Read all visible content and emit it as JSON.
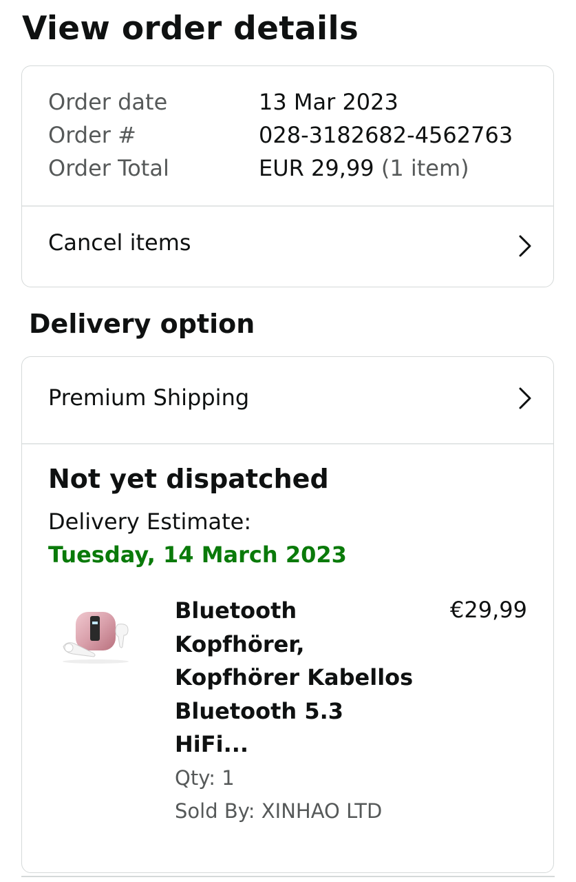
{
  "page": {
    "title": "View order details"
  },
  "order_summary": {
    "rows": [
      {
        "label": "Order date",
        "value": "13 Mar 2023",
        "suffix": ""
      },
      {
        "label": "Order #",
        "value": "028-3182682-4562763",
        "suffix": ""
      },
      {
        "label": "Order Total",
        "value": "EUR 29,99",
        "suffix": "(1 item)"
      }
    ],
    "cancel_label": "Cancel items"
  },
  "delivery": {
    "section_title": "Delivery option",
    "shipping_label": "Premium Shipping",
    "status": "Not yet dispatched",
    "estimate_label": "Delivery Estimate:",
    "estimate_date": "Tuesday, 14 March 2023",
    "item": {
      "title_lines": [
        "Bluetooth",
        "Kopfhörer,",
        "Kopfhörer Kabellos",
        "Bluetooth 5.3",
        "HiFi..."
      ],
      "price": "€29,99",
      "qty": "Qty: 1",
      "seller": "Sold By: XINHAO LTD",
      "image_icon": "earbuds-product-image"
    }
  },
  "colors": {
    "text": "#0f1111",
    "muted": "#565959",
    "border": "#d5d9d9",
    "delivery_green": "#0a7a0a",
    "product_pink": "#d9a0ab"
  }
}
